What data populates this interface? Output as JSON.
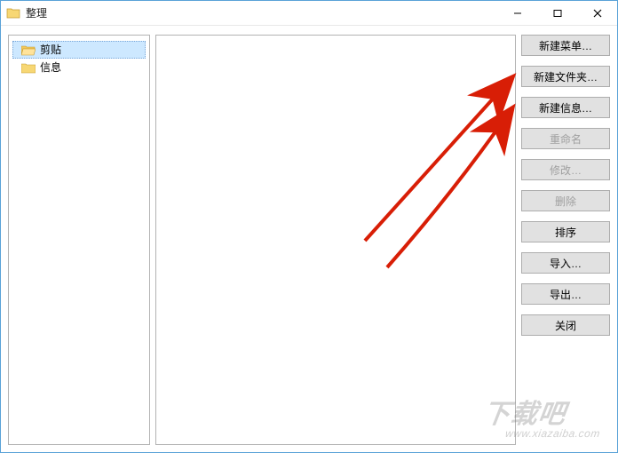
{
  "window": {
    "title": "整理"
  },
  "tree": {
    "items": [
      {
        "label": "剪贴",
        "selected": true
      },
      {
        "label": "信息",
        "selected": false
      }
    ]
  },
  "buttons": {
    "new_menu": "新建菜单…",
    "new_folder": "新建文件夹…",
    "new_info": "新建信息…",
    "rename": "重命名",
    "modify": "修改…",
    "delete": "删除",
    "sort": "排序",
    "import": "导入…",
    "export": "导出…",
    "close": "关闭"
  },
  "watermark": {
    "main": "下载吧",
    "sub": "www.xiazaiba.com"
  },
  "colors": {
    "window_border": "#5aa2d8",
    "pane_border": "#b3b3b3",
    "button_bg": "#e1e1e1",
    "button_border": "#adadad",
    "selection_bg": "#cde8ff",
    "annotation_arrow": "#d81e06"
  }
}
